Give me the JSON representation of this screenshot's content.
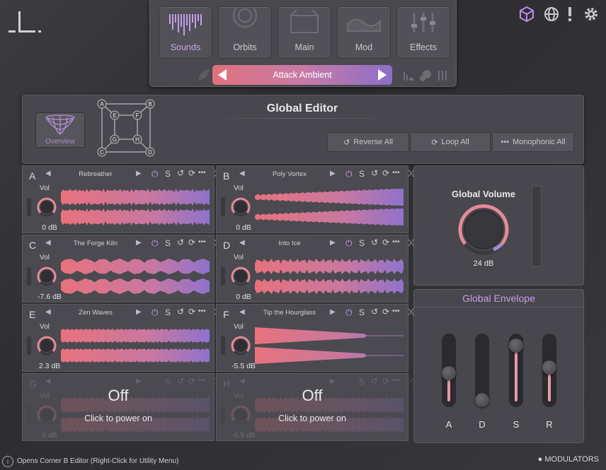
{
  "nav": {
    "tabs": [
      {
        "label": "Sounds",
        "active": true
      },
      {
        "label": "Orbits",
        "active": false
      },
      {
        "label": "Main",
        "active": false
      },
      {
        "label": "Mod",
        "active": false
      },
      {
        "label": "Effects",
        "active": false
      }
    ],
    "preset_name": "Attack Ambient"
  },
  "global_editor": {
    "title": "Global Editor",
    "overview_label": "Overview",
    "map_nodes": [
      "A",
      "B",
      "C",
      "D",
      "E",
      "F",
      "G",
      "H"
    ],
    "reverse_all": "Reverse All",
    "loop_all": "Loop All",
    "monophonic_all": "Monophonic All"
  },
  "cells": [
    {
      "letter": "A",
      "name": "Rebreather",
      "vol_label": "Vol",
      "db": "0 dB",
      "power": true
    },
    {
      "letter": "B",
      "name": "Poly Vortex",
      "vol_label": "Vol",
      "db": "0 dB",
      "power": true
    },
    {
      "letter": "C",
      "name": "The Forge Kiln",
      "vol_label": "Vol",
      "db": "-7.6 dB",
      "power": true
    },
    {
      "letter": "D",
      "name": "Into Ice",
      "vol_label": "Vol",
      "db": "0 dB",
      "power": true
    },
    {
      "letter": "E",
      "name": "Zen Waves",
      "vol_label": "Vol",
      "db": "2.3 dB",
      "power": true
    },
    {
      "letter": "F",
      "name": "Tip the Hourglass",
      "vol_label": "Vol",
      "db": "-5.5 dB",
      "power": true
    },
    {
      "letter": "G",
      "name": "",
      "vol_label": "Vol",
      "db": "0 dB",
      "power": false,
      "off_text": "Off",
      "click_text": "Click to power on"
    },
    {
      "letter": "H",
      "name": "",
      "vol_label": "Vol",
      "db": "-6.5 dB",
      "power": false,
      "off_text": "Off",
      "click_text": "Click to power on"
    }
  ],
  "global_volume": {
    "title": "Global Volume",
    "value": "24 dB"
  },
  "global_envelope": {
    "title": "Global Envelope",
    "faders": [
      {
        "label": "A",
        "level": 0.45
      },
      {
        "label": "D",
        "level": 0.0
      },
      {
        "label": "S",
        "level": 0.92
      },
      {
        "label": "R",
        "level": 0.55
      }
    ]
  },
  "status": {
    "message": "Opens Corner B Editor (Right-Click for Utility Menu)",
    "modulators": "MODULATORS"
  },
  "colors": {
    "accent_purple": "#b98ee6",
    "accent_pink": "#e07a86",
    "panel": "#48474d"
  }
}
